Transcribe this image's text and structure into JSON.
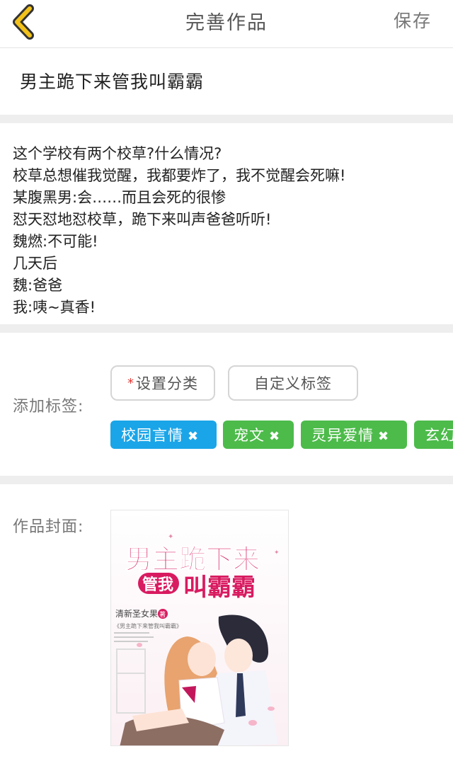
{
  "header": {
    "title": "完善作品",
    "save_label": "保存"
  },
  "work": {
    "title": "男主跪下来管我叫霸霸"
  },
  "description": {
    "lines": [
      "这个学校有两个校草?什么情况?",
      "校草总想催我觉醒，我都要炸了，我不觉醒会死嘛!",
      "某腹黑男:会……而且会死的很惨",
      "怼天怼地怼校草，跪下来叫声爸爸听听!",
      "魏燃:不可能!",
      "几天后",
      "魏:爸爸",
      "我:咦~真香!"
    ]
  },
  "tags": {
    "label": "添加标签:",
    "required_mark": "*",
    "category_button": "设置分类",
    "custom_button": "自定义标签",
    "remove_symbol": "✖",
    "chips": [
      {
        "text": "校园言情",
        "color": "#1aa5e8"
      },
      {
        "text": "宠文",
        "color": "#4cbb4a"
      },
      {
        "text": "灵异爱情",
        "color": "#4cbb4a"
      },
      {
        "text": "玄幻",
        "color": "#4cbb4a"
      }
    ]
  },
  "cover": {
    "label": "作品封面:",
    "title_line1": "男主跪下来",
    "title_line2a": "管我",
    "title_line2b": "叫霸霸",
    "author": "清新圣女果",
    "author_badge": "著",
    "subtitle": "《男主跪下来管我叫霸霸》",
    "accent_color": "#d81b60"
  },
  "colors": {
    "accent_back": "#f2c21b",
    "tag_blue": "#1aa5e8",
    "tag_green": "#4cbb4a",
    "divider": "#eeeeee"
  }
}
